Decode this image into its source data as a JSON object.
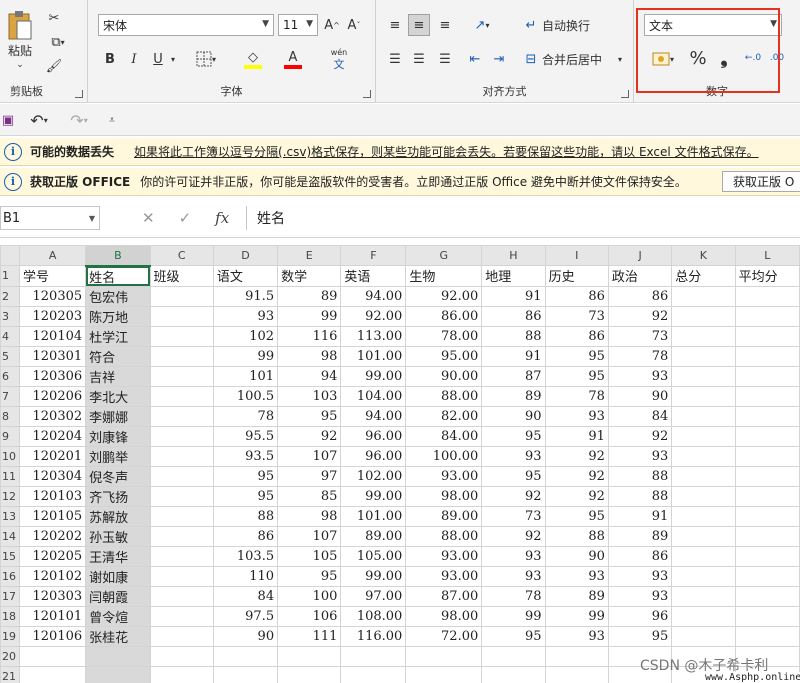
{
  "ribbon": {
    "clipboard": {
      "paste": "粘贴",
      "label": "剪贴板"
    },
    "font": {
      "name": "宋体",
      "size": "11",
      "grow": "A^",
      "shrink": "A˅",
      "bold": "B",
      "italic": "I",
      "underline": "U",
      "wen": "wén",
      "wen2": "文",
      "label": "字体"
    },
    "align": {
      "wrap": "自动换行",
      "merge": "合并后居中",
      "label": "对齐方式"
    },
    "number": {
      "format": "文本",
      "percent": "%",
      "comma": "❟",
      "inc": "←.0",
      "dec": ".00",
      "label": "数字"
    }
  },
  "msgbars": [
    {
      "title": "可能的数据丢失",
      "text": "如果将此工作簿以逗号分隔(.csv)格式保存，则某些功能可能会丢失。若要保留这些功能，请以 Excel 文件格式保存。"
    },
    {
      "title": "获取正版 OFFICE",
      "text": "你的许可证并非正版，你可能是盗版软件的受害者。立即通过正版 Office 避免中断并使文件保持安全。",
      "button": "获取正版 O"
    }
  ],
  "formula": {
    "namebox": "B1",
    "content": "姓名",
    "fx": "fx"
  },
  "columns": [
    "A",
    "B",
    "C",
    "D",
    "E",
    "F",
    "G",
    "H",
    "I",
    "J",
    "K",
    "L"
  ],
  "headers": [
    "学号",
    "姓名",
    "班级",
    "语文",
    "数学",
    "英语",
    "生物",
    "地理",
    "历史",
    "政治",
    "总分",
    "平均分"
  ],
  "rows": [
    [
      "120305",
      "包宏伟",
      "",
      "91.5",
      "89",
      "94.00",
      "92.00",
      "91",
      "86",
      "86"
    ],
    [
      "120203",
      "陈万地",
      "",
      "93",
      "99",
      "92.00",
      "86.00",
      "86",
      "73",
      "92"
    ],
    [
      "120104",
      "杜学江",
      "",
      "102",
      "116",
      "113.00",
      "78.00",
      "88",
      "86",
      "73"
    ],
    [
      "120301",
      "符合",
      "",
      "99",
      "98",
      "101.00",
      "95.00",
      "91",
      "95",
      "78"
    ],
    [
      "120306",
      "吉祥",
      "",
      "101",
      "94",
      "99.00",
      "90.00",
      "87",
      "95",
      "93"
    ],
    [
      "120206",
      "李北大",
      "",
      "100.5",
      "103",
      "104.00",
      "88.00",
      "89",
      "78",
      "90"
    ],
    [
      "120302",
      "李娜娜",
      "",
      "78",
      "95",
      "94.00",
      "82.00",
      "90",
      "93",
      "84"
    ],
    [
      "120204",
      "刘康锋",
      "",
      "95.5",
      "92",
      "96.00",
      "84.00",
      "95",
      "91",
      "92"
    ],
    [
      "120201",
      "刘鹏举",
      "",
      "93.5",
      "107",
      "96.00",
      "100.00",
      "93",
      "92",
      "93"
    ],
    [
      "120304",
      "倪冬声",
      "",
      "95",
      "97",
      "102.00",
      "93.00",
      "95",
      "92",
      "88"
    ],
    [
      "120103",
      "齐飞扬",
      "",
      "95",
      "85",
      "99.00",
      "98.00",
      "92",
      "92",
      "88"
    ],
    [
      "120105",
      "苏解放",
      "",
      "88",
      "98",
      "101.00",
      "89.00",
      "73",
      "95",
      "91"
    ],
    [
      "120202",
      "孙玉敏",
      "",
      "86",
      "107",
      "89.00",
      "88.00",
      "92",
      "88",
      "89"
    ],
    [
      "120205",
      "王清华",
      "",
      "103.5",
      "105",
      "105.00",
      "93.00",
      "93",
      "90",
      "86"
    ],
    [
      "120102",
      "谢如康",
      "",
      "110",
      "95",
      "99.00",
      "93.00",
      "93",
      "93",
      "93"
    ],
    [
      "120303",
      "闫朝霞",
      "",
      "84",
      "100",
      "97.00",
      "87.00",
      "78",
      "89",
      "93"
    ],
    [
      "120101",
      "曾令煊",
      "",
      "97.5",
      "106",
      "108.00",
      "98.00",
      "99",
      "99",
      "96"
    ],
    [
      "120106",
      "张桂花",
      "",
      "90",
      "111",
      "116.00",
      "72.00",
      "95",
      "93",
      "95"
    ]
  ],
  "watermark": "CSDN @木子希卡利",
  "watermark2": "www.Asphp.online"
}
